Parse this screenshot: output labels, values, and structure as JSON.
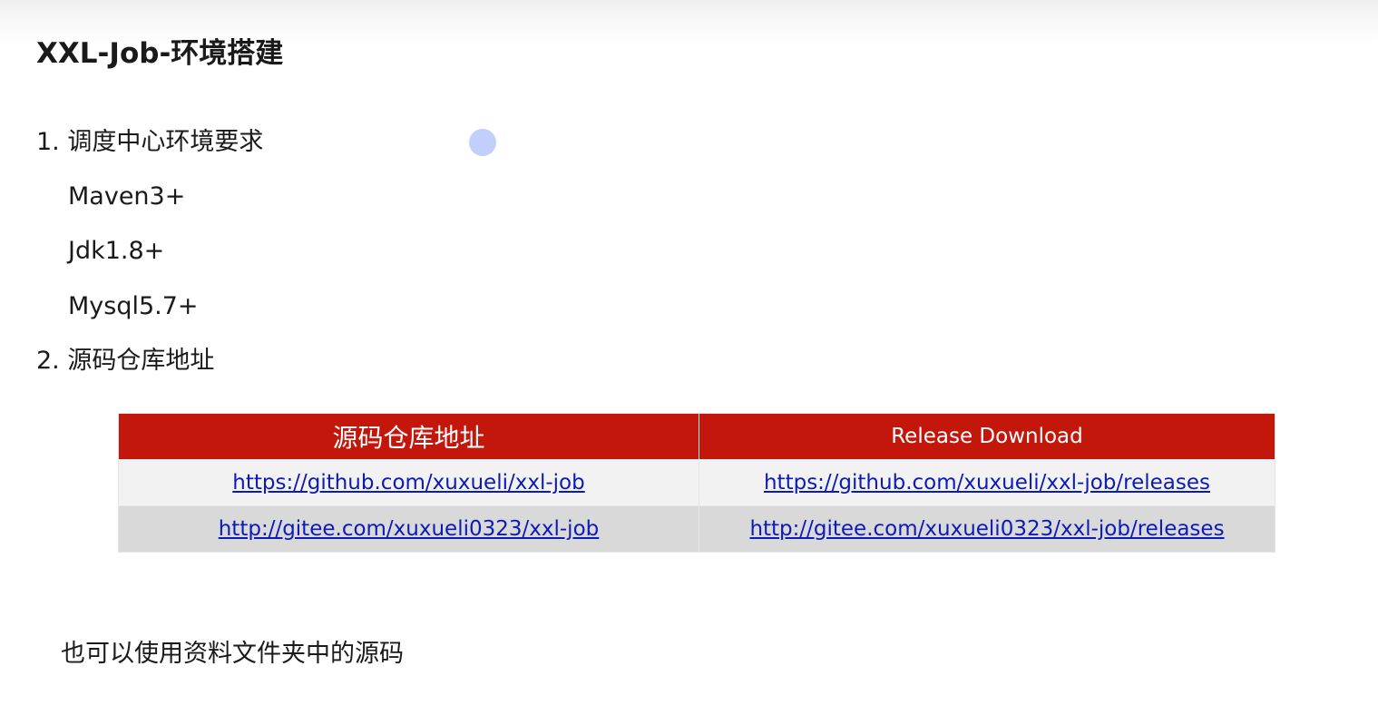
{
  "title": "XXL-Job-环境搭建",
  "section1": {
    "heading": "1. 调度中心环境要求",
    "requirements": [
      "Maven3+",
      "Jdk1.8+",
      "Mysql5.7+"
    ]
  },
  "section2": {
    "heading": "2. 源码仓库地址"
  },
  "table": {
    "headers": [
      "源码仓库地址",
      "Release Download"
    ],
    "rows": [
      [
        "https://github.com/xuxueli/xxl-job",
        "https://github.com/xuxueli/xxl-job/releases"
      ],
      [
        "http://gitee.com/xuxueli0323/xxl-job",
        "http://gitee.com/xuxueli0323/xxl-job/releases"
      ]
    ]
  },
  "note": "也可以使用资料文件夹中的源码",
  "colors": {
    "header_bg": "#c3170c",
    "link": "#0c1bb6",
    "row_light": "#f2f2f2",
    "row_dark": "#d9d9d9",
    "cursor": "#c3cffb"
  }
}
